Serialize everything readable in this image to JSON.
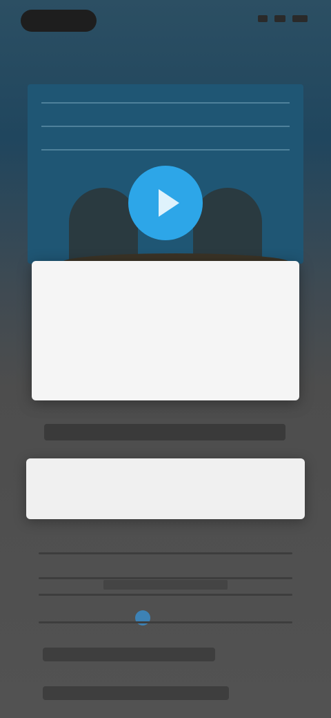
{
  "status_bar": {
    "time": "",
    "icons": [
      "signal-icon",
      "wifi-icon",
      "battery-icon"
    ]
  },
  "header": {
    "title": ""
  },
  "hero": {
    "play_icon": "play-icon"
  },
  "modal": {
    "text": ""
  },
  "section": {
    "heading": ""
  },
  "primary_button": {
    "label": ""
  },
  "list": {
    "items": [
      "",
      ""
    ]
  },
  "colors": {
    "accent": "#2da6e8",
    "hero_bg": "#1f5674",
    "card_bg": "#f5f5f5",
    "page_bg": "#4d4d4d"
  }
}
